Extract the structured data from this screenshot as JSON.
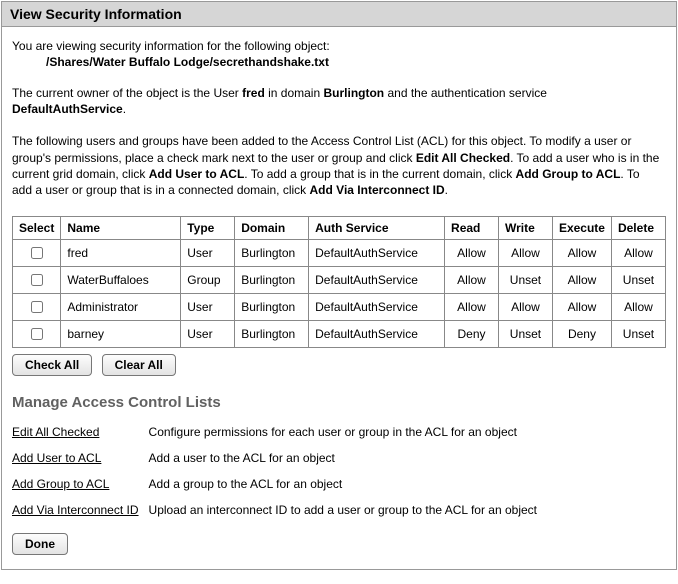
{
  "title": "View Security Information",
  "intro": "You are viewing security information for the following object:",
  "object_path": "/Shares/Water Buffalo Lodge/secrethandshake.txt",
  "owner_para": {
    "p1": "The current owner of the object is the User ",
    "user": "fred",
    "p2": " in domain ",
    "domain": "Burlington",
    "p3": " and the authentication service ",
    "service": "DefaultAuthService",
    "p4": "."
  },
  "acl_para": {
    "t1": "The following users and groups have been added to the Access Control List (ACL) for this object. To modify a user or group's permissions, place a check mark next to the user or group and click ",
    "b1": "Edit All Checked",
    "t2": ". To add a user who is in the current grid domain, click ",
    "b2": "Add User to ACL",
    "t3": ". To add a group that is in the current domain, click ",
    "b3": "Add Group to ACL",
    "t4": ". To add a user or group that is in a connected domain, click ",
    "b4": "Add Via Interconnect ID",
    "t5": "."
  },
  "table": {
    "headers": {
      "select": "Select",
      "name": "Name",
      "type": "Type",
      "domain": "Domain",
      "auth": "Auth Service",
      "read": "Read",
      "write": "Write",
      "execute": "Execute",
      "delete": "Delete"
    },
    "rows": [
      {
        "name": "fred",
        "type": "User",
        "domain": "Burlington",
        "auth": "DefaultAuthService",
        "read": "Allow",
        "write": "Allow",
        "execute": "Allow",
        "delete": "Allow"
      },
      {
        "name": "WaterBuffaloes",
        "type": "Group",
        "domain": "Burlington",
        "auth": "DefaultAuthService",
        "read": "Allow",
        "write": "Unset",
        "execute": "Allow",
        "delete": "Unset"
      },
      {
        "name": "Administrator",
        "type": "User",
        "domain": "Burlington",
        "auth": "DefaultAuthService",
        "read": "Allow",
        "write": "Allow",
        "execute": "Allow",
        "delete": "Allow"
      },
      {
        "name": "barney",
        "type": "User",
        "domain": "Burlington",
        "auth": "DefaultAuthService",
        "read": "Deny",
        "write": "Unset",
        "execute": "Deny",
        "delete": "Unset"
      }
    ]
  },
  "buttons": {
    "check_all": "Check All",
    "clear_all": "Clear All",
    "done": "Done"
  },
  "manage": {
    "heading": "Manage Access Control Lists",
    "actions": [
      {
        "label": "Edit All Checked",
        "desc": "Configure permissions for each user or group in the ACL for an object"
      },
      {
        "label": "Add User to ACL",
        "desc": "Add a user to the ACL for an object"
      },
      {
        "label": "Add Group to ACL",
        "desc": "Add a group to the ACL for an object"
      },
      {
        "label": "Add Via Interconnect ID",
        "desc": "Upload an interconnect ID to add a user or group to the ACL for an object"
      }
    ]
  }
}
